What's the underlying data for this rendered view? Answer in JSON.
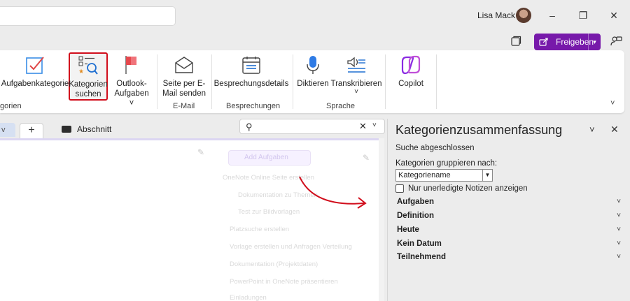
{
  "titlebar": {
    "user_name": "Lisa Mack",
    "minimize_glyph": "–",
    "restore_glyph": "❐",
    "close_glyph": "✕"
  },
  "toolbar": {
    "share_label": "Freigeben",
    "share_icon": "share-icon",
    "share_color": "#7719aa"
  },
  "ribbon": {
    "buttons": {
      "aufgabenkategorie": "Aufgabenkategorie",
      "kategorien_suchen": "Kategorien suchen",
      "outlook_aufgaben": "Outlook-Aufgaben ˅",
      "seite_email": "Seite per E-Mail senden",
      "besprechungsdetails": "Besprechungsdetails",
      "diktieren": "Diktieren",
      "transkribieren": "Transkribieren",
      "transkribieren_dd": "˅",
      "copilot": "Copilot"
    },
    "groups": {
      "kategorien": "gorien",
      "email": "E-Mail",
      "besprechungen": "Besprechungen",
      "sprache": "Sprache"
    },
    "highlight_color": "#d10e1c"
  },
  "tabs": {
    "partial_tab": "v",
    "add_tab": "+",
    "section_label": "Abschnitt"
  },
  "page_search": {
    "placeholder": "",
    "clear_glyph": "✕",
    "dropdown_glyph": "˅"
  },
  "page": {
    "task_pill": "Add Aufgaben",
    "faded_lines": [
      "OneNote Online Seite erstellen",
      "Dokumentation zu Themen",
      "Test zur Bildvorlagen",
      "Platzsuche erstellen",
      "Vorlage erstellen und Anfragen Verteilung",
      "Dokumentation (Projektdaten)",
      "PowerPoint in OneNote präsentieren",
      "Einladungen"
    ]
  },
  "panel": {
    "title": "Kategorienzusammenfassung",
    "status": "Suche abgeschlossen",
    "group_by_label": "Kategorien gruppieren nach:",
    "group_by_value": "Kategoriename",
    "checkbox_label": "Nur unerledigte Notizen anzeigen",
    "categories": [
      {
        "label": "Aufgaben"
      },
      {
        "label": "Definition"
      },
      {
        "label": "Heute"
      },
      {
        "label": "Kein Datum"
      },
      {
        "label": "Teilnehmend"
      }
    ],
    "annotation_arrow_color": "#d10e1c"
  }
}
